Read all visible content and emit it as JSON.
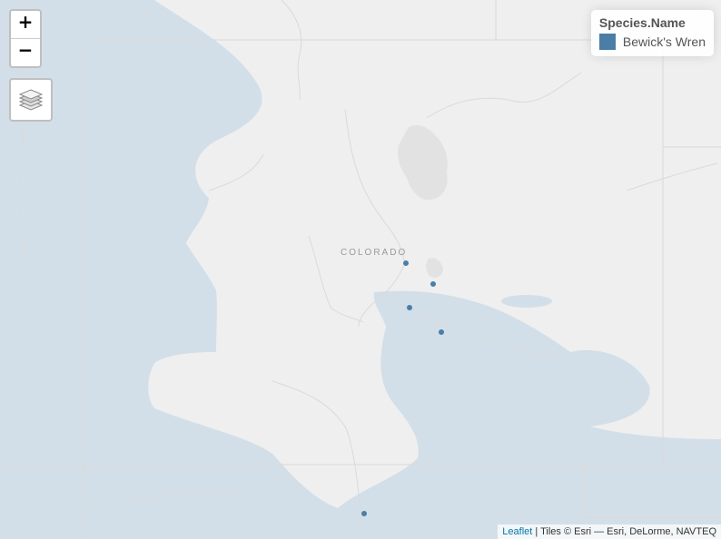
{
  "controls": {
    "zoom_in_label": "+",
    "zoom_out_label": "−",
    "layers_icon": "layers-icon"
  },
  "legend": {
    "title": "Species.Name",
    "items": [
      {
        "label": "Bewick's Wren",
        "color": "#4a7ea6"
      }
    ]
  },
  "map": {
    "state_label": "COLORADO",
    "water_color": "#d3dfe8",
    "land_color": "#efefef",
    "point_color": "#4a7ea6",
    "observation_count": 5
  },
  "attribution": {
    "link_text": "Leaflet",
    "rest": " | Tiles © Esri — Esri, DeLorme, NAVTEQ"
  }
}
